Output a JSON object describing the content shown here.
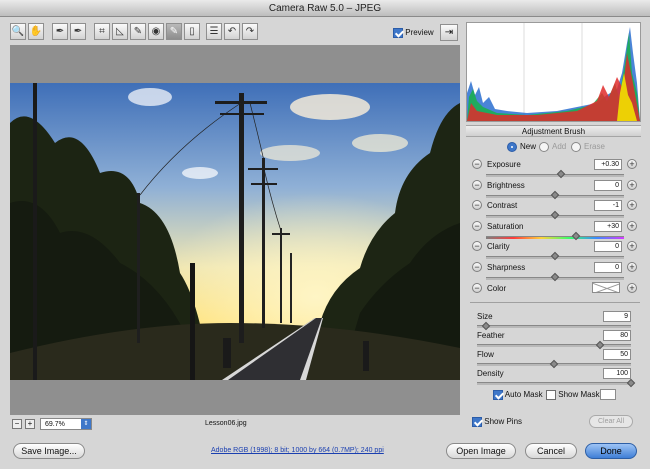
{
  "window": {
    "title": "Camera Raw 5.0  –  JPEG"
  },
  "toolbar": {
    "tools": [
      {
        "name": "zoom-tool",
        "glyph": "🔍"
      },
      {
        "name": "hand-tool",
        "glyph": "✋"
      },
      {
        "name": "white-balance-tool",
        "glyph": "✒"
      },
      {
        "name": "color-sampler-tool",
        "glyph": "✒"
      },
      {
        "name": "crop-tool",
        "glyph": "⌗"
      },
      {
        "name": "straighten-tool",
        "glyph": "◺"
      },
      {
        "name": "spot-removal-tool",
        "glyph": "✎"
      },
      {
        "name": "red-eye-tool",
        "glyph": "◉"
      },
      {
        "name": "adjustment-brush-tool",
        "glyph": "✎"
      },
      {
        "name": "graduated-filter-tool",
        "glyph": "▯"
      },
      {
        "name": "preferences-tool",
        "glyph": "☰"
      },
      {
        "name": "rotate-left-tool",
        "glyph": "↶"
      },
      {
        "name": "rotate-right-tool",
        "glyph": "↷"
      }
    ],
    "preview_label": "Preview",
    "preview_checked": true,
    "export_glyph": "⇥"
  },
  "statusbar": {
    "zoom_out": "−",
    "zoom_in": "+",
    "zoom_value": "69.7%",
    "filename": "Lesson06.jpg"
  },
  "panel": {
    "title": "Adjustment Brush",
    "modes": [
      {
        "label": "New",
        "selected": true
      },
      {
        "label": "Add",
        "selected": false
      },
      {
        "label": "Erase",
        "selected": false
      }
    ],
    "adjustments": [
      {
        "label": "Exposure",
        "value": "+0.30",
        "position": 0.54
      },
      {
        "label": "Brightness",
        "value": "0",
        "position": 0.5
      },
      {
        "label": "Contrast",
        "value": "-1",
        "position": 0.5
      },
      {
        "label": "Saturation",
        "value": "+30",
        "position": 0.65
      },
      {
        "label": "Clarity",
        "value": "0",
        "position": 0.5
      },
      {
        "label": "Sharpness",
        "value": "0",
        "position": 0.5
      }
    ],
    "color_label": "Color",
    "brush": [
      {
        "label": "Size",
        "value": "9",
        "position": 0.06
      },
      {
        "label": "Feather",
        "value": "80",
        "position": 0.8
      },
      {
        "label": "Flow",
        "value": "50",
        "position": 0.5
      },
      {
        "label": "Density",
        "value": "100",
        "position": 1.0
      }
    ],
    "auto_mask_label": "Auto Mask",
    "auto_mask_checked": true,
    "show_mask_label": "Show Mask",
    "show_mask_checked": false,
    "show_pins_label": "Show Pins",
    "show_pins_checked": true,
    "clear_all_label": "Clear All"
  },
  "footer": {
    "save_image": "Save Image...",
    "info": "Adobe RGB (1998); 8 bit; 1000 by 664 (0.7MP); 240 ppi",
    "open_image": "Open Image",
    "cancel": "Cancel",
    "done": "Done"
  },
  "colors": {
    "accent": "#3e77c9",
    "saturation_gradient": [
      "#7f7f7f",
      "#ff3b3b",
      "#ffd23b",
      "#3bff6a",
      "#3b8bff",
      "#d63bff"
    ]
  }
}
